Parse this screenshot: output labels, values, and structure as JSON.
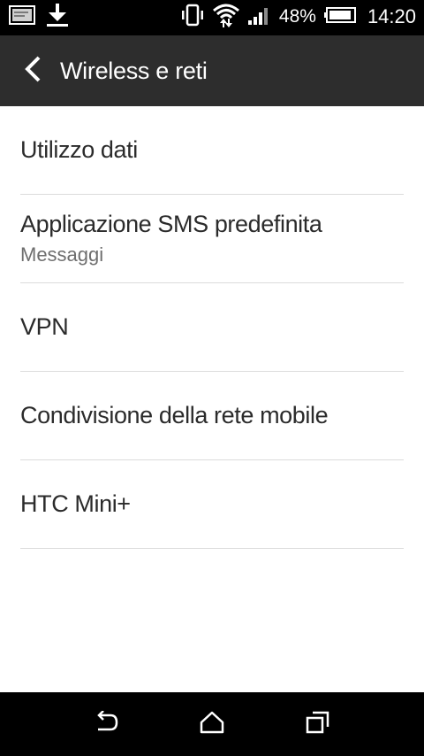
{
  "status_bar": {
    "icons_left": [
      "image-notification-icon",
      "download-icon"
    ],
    "icons_right": [
      "vibrate-icon",
      "wifi-icon",
      "signal-icon"
    ],
    "battery_percent": "48%",
    "battery_level": 0.48,
    "time": "14:20"
  },
  "action_bar": {
    "title": "Wireless e reti",
    "background": "#2d2d2d"
  },
  "list": {
    "items": [
      {
        "title": "Utilizzo dati",
        "subtitle": null
      },
      {
        "title": "Applicazione SMS predefinita",
        "subtitle": "Messaggi"
      },
      {
        "title": "VPN",
        "subtitle": null
      },
      {
        "title": "Condivisione della rete mobile",
        "subtitle": null
      },
      {
        "title": "HTC Mini+",
        "subtitle": null
      }
    ]
  },
  "nav_bar": {
    "buttons": [
      "back-icon",
      "home-icon",
      "recent-apps-icon"
    ]
  }
}
